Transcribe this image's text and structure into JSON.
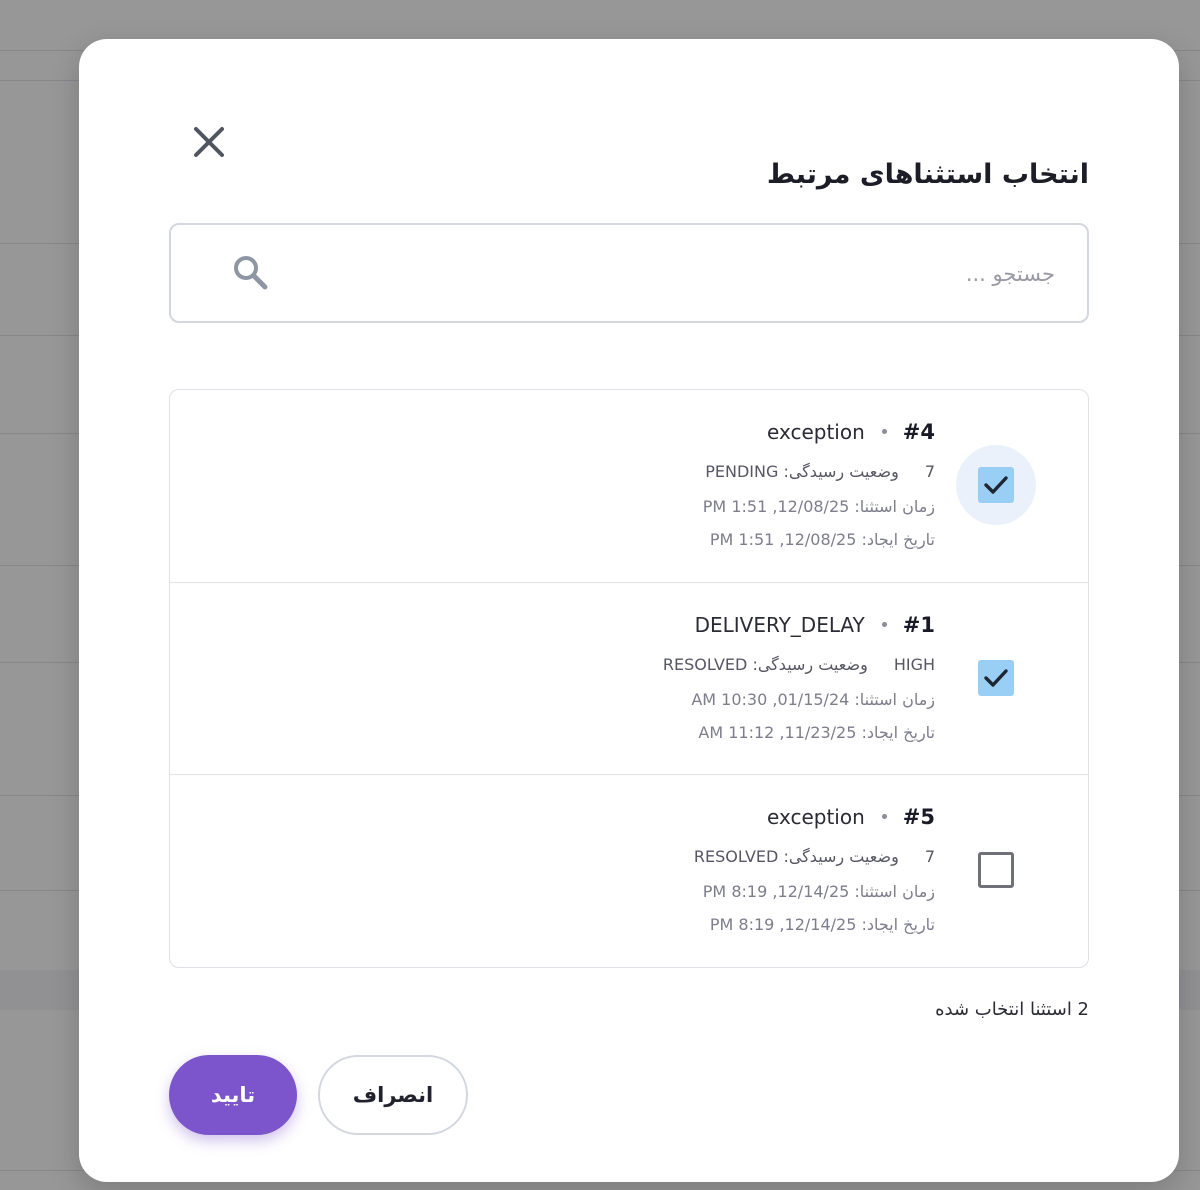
{
  "dialog": {
    "title": "انتخاب استثناهای مرتبط",
    "close_icon": "close-icon"
  },
  "search": {
    "placeholder": "جستجو ...",
    "value": "",
    "icon": "search-icon"
  },
  "exceptions": [
    {
      "id": "#4",
      "type": "exception",
      "priority": "7",
      "status_label": "وضعیت رسیدگی: PENDING",
      "exception_time": "زمان استثنا: 12/08/25, 1:51 PM",
      "created_at": "تاریخ ایجاد: 12/08/25, 1:51 PM",
      "checked": true
    },
    {
      "id": "#1",
      "type": "DELIVERY_DELAY",
      "priority": "HIGH",
      "status_label": "وضعیت رسیدگی: RESOLVED",
      "exception_time": "زمان استثنا: 01/15/24, 10:30 AM",
      "created_at": "تاریخ ایجاد: 11/23/25, 11:12 AM",
      "checked": true
    },
    {
      "id": "#5",
      "type": "exception",
      "priority": "7",
      "status_label": "وضعیت رسیدگی: RESOLVED",
      "exception_time": "زمان استثنا: 12/14/25, 8:19 PM",
      "created_at": "تاریخ ایجاد: 12/14/25, 8:19 PM",
      "checked": false
    }
  ],
  "footer": {
    "selected_count": "2 استثنا انتخاب شده",
    "confirm_label": "تایید",
    "cancel_label": "انصراف"
  },
  "colors": {
    "primary": "#7c54cc",
    "checkbox_checked": "#99cff5",
    "text_dark": "#1d1d28",
    "text_muted": "#7d7d8c"
  }
}
